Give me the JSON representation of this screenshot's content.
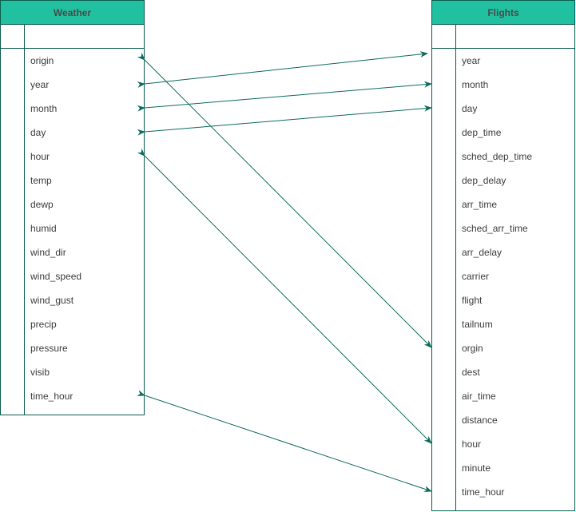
{
  "weather": {
    "title": "Weather",
    "fields": [
      "origin",
      "year",
      "month",
      "day",
      "hour",
      "temp",
      "dewp",
      "humid",
      "wind_dir",
      "wind_speed",
      "wind_gust",
      "precip",
      "pressure",
      "visib",
      "time_hour"
    ]
  },
  "flights": {
    "title": "Flights",
    "fields": [
      "year",
      "month",
      "day",
      "dep_time",
      "sched_dep_time",
      "dep_delay",
      "arr_time",
      "sched_arr_time",
      "arr_delay",
      "carrier",
      "flight",
      "tailnum",
      "orgin",
      "dest",
      "air_time",
      "distance",
      "hour",
      "minute",
      "time_hour"
    ]
  },
  "relationships": [
    {
      "from": "origin",
      "to": "orgin"
    },
    {
      "from": "year",
      "to": "year"
    },
    {
      "from": "month",
      "to": "month"
    },
    {
      "from": "day",
      "to": "day"
    },
    {
      "from": "hour",
      "to": "hour"
    },
    {
      "from": "time_hour",
      "to": "time_hour"
    }
  ],
  "colors": {
    "header": "#21c0a0",
    "border": "#0b5c4f",
    "link": "#0b6b5c"
  }
}
